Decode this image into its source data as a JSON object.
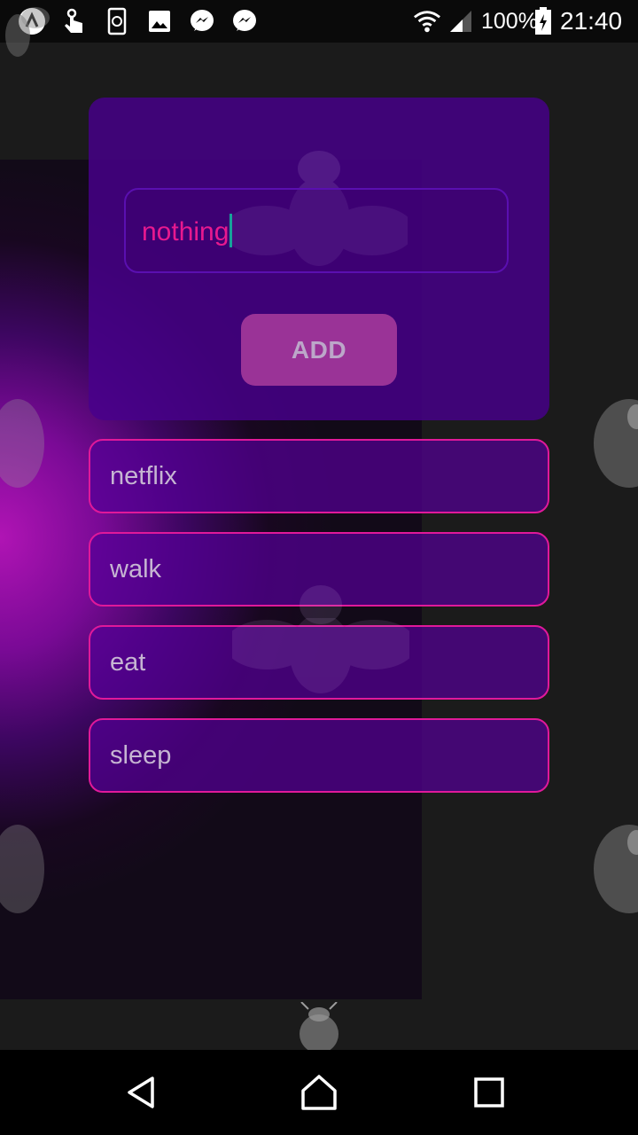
{
  "status_bar": {
    "battery": "100%",
    "time": "21:40",
    "icons": [
      "app-icon",
      "touch-icon",
      "sync-icon",
      "image-icon",
      "messenger-icon",
      "messenger-icon",
      "wifi-icon",
      "signal-icon",
      "battery-charging-icon"
    ]
  },
  "input": {
    "value": "nothing"
  },
  "add_label": "ADD",
  "todos": [
    {
      "label": "netflix"
    },
    {
      "label": "walk"
    },
    {
      "label": "eat"
    },
    {
      "label": "sleep"
    }
  ],
  "nav": {
    "icons": [
      "back-icon",
      "home-icon",
      "recents-icon"
    ]
  },
  "colors": {
    "accent_pink": "#e0199a",
    "card_purple": "#48008c",
    "button": "#9a3397",
    "caret": "#17a39a"
  }
}
